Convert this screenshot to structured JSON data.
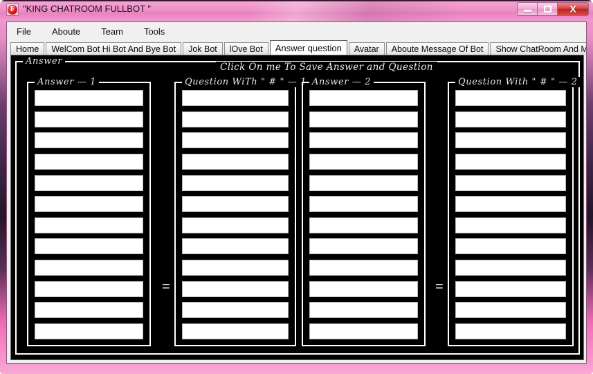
{
  "window": {
    "title": "\"KING CHATROOM FULLBOT \"",
    "icon": "app-logo-f-icon",
    "controls": {
      "minimize": "minimize-button",
      "maximize": "maximize-button",
      "close": "close-button",
      "close_glyph": "X"
    },
    "colors": {
      "titlebar_pink": "#f29cd0",
      "frame_purple": "#3b2345",
      "close_red": "#bc2020",
      "page_black": "#000000"
    }
  },
  "menu": {
    "items": [
      {
        "label": "File"
      },
      {
        "label": "Aboute"
      },
      {
        "label": "Team"
      },
      {
        "label": "Tools"
      }
    ]
  },
  "tabs": {
    "selected_index": 5,
    "items": [
      {
        "label": "Home"
      },
      {
        "label": "WelCom Bot Hi Bot And Bye Bot"
      },
      {
        "label": "Jok Bot"
      },
      {
        "label": "lOve Bot"
      },
      {
        "label": "Answer question"
      },
      {
        "label": "Avatar"
      },
      {
        "label": "Aboute Message Of Bot"
      },
      {
        "label": "Show ChatRoom And Message"
      }
    ]
  },
  "main": {
    "outer_group_label": "Answer",
    "save_link": "Click On me To Save Answer and Question",
    "separator_1": "=",
    "separator_2": "=",
    "columns": [
      {
        "label": "Answer — 1",
        "rows": [
          "",
          "",
          "",
          "",
          "",
          "",
          "",
          "",
          "",
          "",
          "",
          ""
        ]
      },
      {
        "label": "Question WiTh \" # \" — 1",
        "rows": [
          "",
          "",
          "",
          "",
          "",
          "",
          "",
          "",
          "",
          "",
          "",
          ""
        ]
      },
      {
        "label": "Answer — 2",
        "rows": [
          "",
          "",
          "",
          "",
          "",
          "",
          "",
          "",
          "",
          "",
          "",
          ""
        ]
      },
      {
        "label": "Question With \" # \" — 2",
        "rows": [
          "",
          "",
          "",
          "",
          "",
          "",
          "",
          "",
          "",
          "",
          "",
          ""
        ]
      }
    ]
  }
}
